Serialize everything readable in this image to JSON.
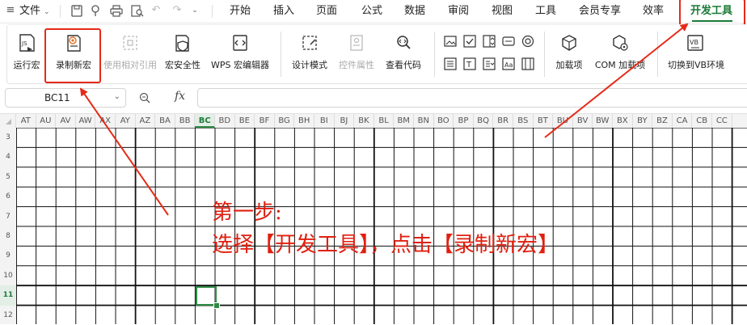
{
  "menubar": {
    "file_label": "文件",
    "tabs": [
      "开始",
      "插入",
      "页面",
      "公式",
      "数据",
      "审阅",
      "视图",
      "工具",
      "会员专享",
      "效率",
      "开发工具"
    ],
    "active_tab": "开发工具"
  },
  "ribbon": {
    "buttons": [
      {
        "label": "运行宏",
        "icon": "run-macro-icon",
        "enabled": true
      },
      {
        "label": "录制新宏",
        "icon": "record-macro-icon",
        "enabled": true
      },
      {
        "label": "使用相对引用",
        "icon": "relative-reference-icon",
        "enabled": false
      },
      {
        "label": "宏安全性",
        "icon": "macro-security-icon",
        "enabled": true
      },
      {
        "label": "WPS 宏编辑器",
        "icon": "macro-editor-icon",
        "enabled": true
      },
      {
        "label": "设计模式",
        "icon": "design-mode-icon",
        "enabled": true
      },
      {
        "label": "控件属性",
        "icon": "control-properties-icon",
        "enabled": false
      },
      {
        "label": "查看代码",
        "icon": "view-code-icon",
        "enabled": true
      },
      {
        "label": "加载项",
        "icon": "add-ins-icon",
        "enabled": true
      },
      {
        "label": "COM 加载项",
        "icon": "com-add-ins-icon",
        "enabled": true
      },
      {
        "label": "切换到VB环境",
        "icon": "switch-vb-icon",
        "enabled": true
      }
    ],
    "controls": [
      "image-control-icon",
      "checkbox-control-icon",
      "spinner-control-icon",
      "button-control-icon",
      "radio-control-icon",
      "listbox-control-icon",
      "textbox-control-icon",
      "combobox-control-icon",
      "label-control-icon",
      "scrollbar-control-icon"
    ],
    "vb_badge": "VB"
  },
  "formula_bar": {
    "name_box": "BC11",
    "fx_label": "fx",
    "formula": ""
  },
  "sheet": {
    "columns": [
      "AT",
      "AU",
      "AV",
      "AW",
      "AX",
      "AY",
      "AZ",
      "BA",
      "BB",
      "BC",
      "BD",
      "BE",
      "BF",
      "BG",
      "BH",
      "BI",
      "BJ",
      "BK",
      "BL",
      "BM",
      "BN",
      "BO",
      "BP",
      "BQ",
      "BR",
      "BS",
      "BT",
      "BU",
      "BV",
      "BW",
      "BX",
      "BY",
      "BZ",
      "CA",
      "CB",
      "CC"
    ],
    "rows": [
      "3",
      "4",
      "5",
      "6",
      "7",
      "8",
      "9",
      "10",
      "11",
      "12"
    ],
    "selected_cell": "BC11"
  },
  "annotation": {
    "line1": "第一步:",
    "line2": "选择【开发工具】，点击【录制新宏】"
  },
  "colors": {
    "accent": "#e52a18",
    "selection": "#2e8b45"
  }
}
